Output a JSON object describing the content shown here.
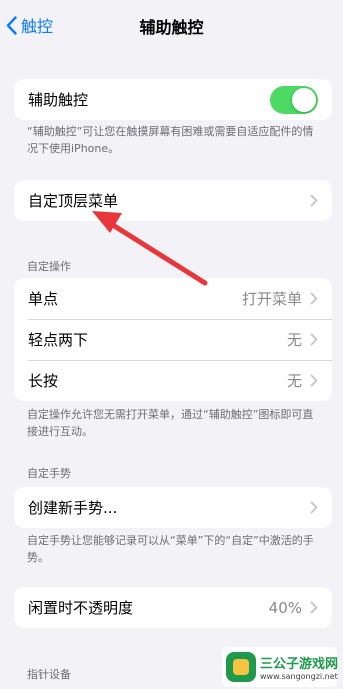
{
  "nav": {
    "back_label": "触控",
    "title": "辅助触控"
  },
  "assistive": {
    "label": "辅助触控",
    "toggle_on": true,
    "footer": "“辅助触控”可让您在触摸屏幕有困难或需要自适应配件的情况下使用iPhone。"
  },
  "top_menu": {
    "label": "自定顶层菜单"
  },
  "custom_actions": {
    "header": "自定操作",
    "rows": [
      {
        "label": "单点",
        "value": "打开菜单"
      },
      {
        "label": "轻点两下",
        "value": "无"
      },
      {
        "label": "长按",
        "value": "无"
      }
    ],
    "footer": "自定操作允许您无需打开菜单，通过“辅助触控”图标即可直接进行互动。"
  },
  "gestures": {
    "header": "自定手势",
    "create_label": "创建新手势...",
    "footer": "自定手势让您能够记录可以从“菜单”下的“自定”中激活的手势。"
  },
  "idle_opacity": {
    "label": "闲置时不透明度",
    "value": "40%"
  },
  "pointer": {
    "header": "指针设备"
  },
  "watermark": {
    "title": "三公子游戏网",
    "url": "www.sangongzi.net"
  },
  "colors": {
    "accent": "#0a7aff",
    "toggle": "#4cd964",
    "annotation_arrow": "#e8373a"
  }
}
